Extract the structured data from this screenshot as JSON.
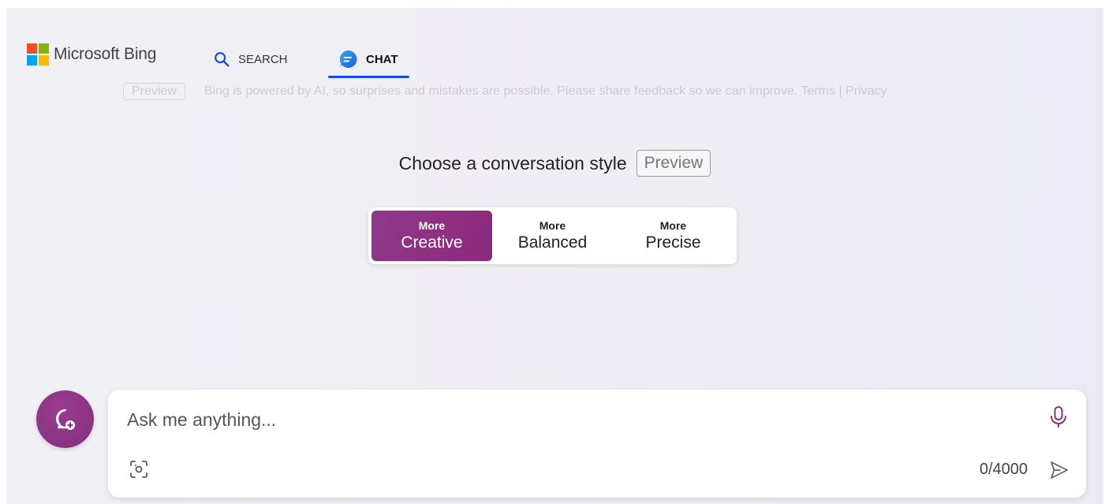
{
  "header": {
    "brand": "Microsoft Bing",
    "tabs": [
      {
        "label": "SEARCH",
        "icon": "search-icon"
      },
      {
        "label": "CHAT",
        "icon": "chat-icon",
        "active": true
      }
    ]
  },
  "disclaimer": {
    "badge": "Preview",
    "text": "Bing is powered by AI, so surprises and mistakes are possible. Please share feedback so we can improve. Terms | Privacy"
  },
  "style_chooser": {
    "title": "Choose a conversation style",
    "badge": "Preview",
    "options": [
      {
        "small": "More",
        "big": "Creative",
        "selected": true
      },
      {
        "small": "More",
        "big": "Balanced",
        "selected": false
      },
      {
        "small": "More",
        "big": "Precise",
        "selected": false
      }
    ]
  },
  "composer": {
    "placeholder": "Ask me anything...",
    "counter": "0/4000"
  },
  "colors": {
    "accent": "#174ae4",
    "creative": "#8d2f82",
    "ms_red": "#f25022",
    "ms_green": "#7fba00",
    "ms_blue": "#00a4ef",
    "ms_yellow": "#ffb900"
  }
}
